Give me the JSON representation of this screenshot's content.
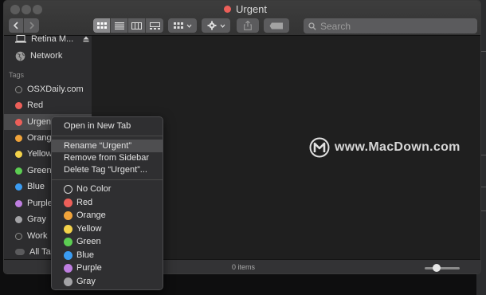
{
  "window": {
    "title": "Urgent",
    "title_tag_color": "#ec5f59"
  },
  "toolbar": {
    "back_icon": "chevron-left-icon",
    "forward_icon": "chevron-right-icon",
    "view_modes": [
      "icon-view-icon",
      "list-view-icon",
      "column-view-icon",
      "gallery-view-icon"
    ],
    "group_icon": "group-by-icon",
    "action_icon": "gear-icon",
    "share_icon": "share-icon",
    "tag_icon": "tag-icon",
    "search_placeholder": "Search"
  },
  "sidebar": {
    "devices": [
      {
        "label": "Retina M...",
        "icon": "laptop-icon"
      },
      {
        "label": "Network",
        "icon": "network-globe-icon"
      }
    ],
    "tags_header": "Tags",
    "tags": [
      {
        "label": "OSXDaily.com",
        "color": "#2f2f2f"
      },
      {
        "label": "Red",
        "color": "#ec5f59"
      },
      {
        "label": "Urgent",
        "color": "#ec5f59"
      },
      {
        "label": "Orange",
        "color": "#f0a33a"
      },
      {
        "label": "Yellow",
        "color": "#f3d24a"
      },
      {
        "label": "Green",
        "color": "#5ccd52"
      },
      {
        "label": "Blue",
        "color": "#3b9cf2"
      },
      {
        "label": "Purple",
        "color": "#be7ee0"
      },
      {
        "label": "Gray",
        "color": "#a3a3a6"
      },
      {
        "label": "Work",
        "color": "#2f2f2f"
      },
      {
        "label": "All Tags...",
        "color": "#5b5b5d"
      }
    ]
  },
  "status": {
    "item_count": "0 items",
    "zoom_level": 0.35
  },
  "context_menu": {
    "open_new_tab": "Open in New Tab",
    "rename": "Rename “Urgent”",
    "remove_sidebar": "Remove from Sidebar",
    "delete_tag": "Delete Tag “Urgent”...",
    "colors": [
      {
        "label": "No Color",
        "color": "none"
      },
      {
        "label": "Red",
        "color": "#ec5f59"
      },
      {
        "label": "Orange",
        "color": "#f0a33a"
      },
      {
        "label": "Yellow",
        "color": "#f3d24a"
      },
      {
        "label": "Green",
        "color": "#5ccd52"
      },
      {
        "label": "Blue",
        "color": "#3b9cf2"
      },
      {
        "label": "Purple",
        "color": "#be7ee0"
      },
      {
        "label": "Gray",
        "color": "#a3a3a6"
      }
    ]
  },
  "watermark": {
    "text": "www.MacDown.com"
  }
}
